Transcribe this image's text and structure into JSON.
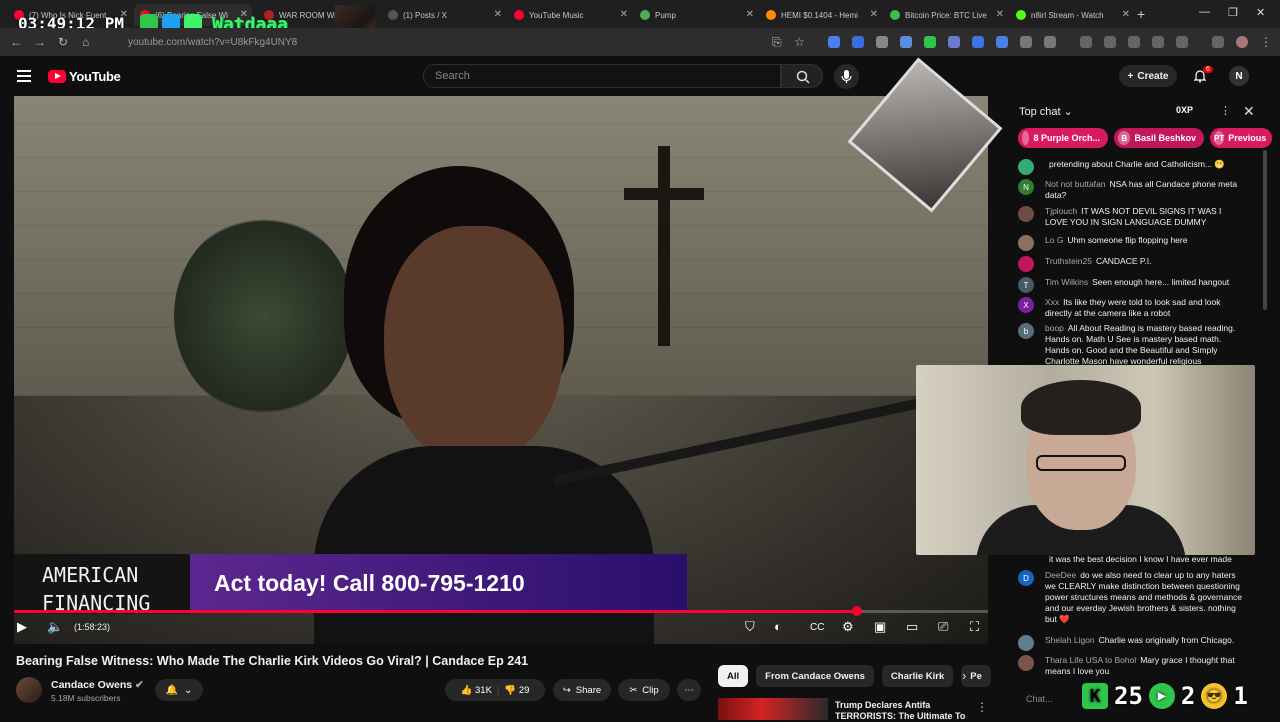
{
  "browser": {
    "clock": "03:49:12 PM",
    "overlay_name": "Watdaaa",
    "tabs": [
      {
        "label": "(7) Who Is Nick Fuent",
        "color": "#ff0033"
      },
      {
        "label": "(6) Bearing False Wi",
        "color": "#ff0033"
      },
      {
        "label": "WAR ROOM Wi",
        "color": "#b02020"
      },
      {
        "label": "(1) Posts / X",
        "color": "#555555"
      },
      {
        "label": "YouTube Music",
        "color": "#ff0033"
      },
      {
        "label": "Pump",
        "color": "#4caf50"
      },
      {
        "label": "HEMI $0.1404 - Hemi",
        "color": "#ff8c00"
      },
      {
        "label": "Bitcoin Price: BTC Live",
        "color": "#3fb950"
      },
      {
        "label": "n8irl Stream - Watch",
        "color": "#53fc18"
      }
    ],
    "url": "youtube.com/watch?v=U8kFkg4UNY8"
  },
  "yt_header": {
    "logo": "YouTube",
    "search_placeholder": "Search",
    "create_label": "Create",
    "notifications": "6",
    "user_initial": "N"
  },
  "video": {
    "ad_brand": "AMERICAN FINANCING",
    "ad_text": "Act today! Call 800-795-1210",
    "time": "(1:58:23)",
    "progress": 0.865
  },
  "chat": {
    "title": "Top chat",
    "xp_label": "0XP",
    "pinned": [
      {
        "label": "8 Purple Orch...",
        "initial": "",
        "color": "#d81b60"
      },
      {
        "label": "Basil Beshkov",
        "initial": "B",
        "color": "#c2185b"
      },
      {
        "label": "Previous",
        "initial": "PT",
        "color": "#d81b60"
      }
    ],
    "messages": [
      {
        "initial": "",
        "author": "",
        "text": "pretending about Charlie and Catholicism... 😬",
        "color": "#3a7"
      },
      {
        "initial": "N",
        "author": "Not not buttafan",
        "text": "NSA has all Candace phone meta data?",
        "color": "#2e7d32"
      },
      {
        "initial": "",
        "author": "Tjplouch",
        "text": "IT WAS NOT DEVIL SIGNS IT WAS I LOVE YOU IN SIGN LANGUAGE DUMMY",
        "color": "#6d4c41"
      },
      {
        "initial": "",
        "author": "Lo G",
        "text": "Uhm someone flip flopping here",
        "color": "#8d6e63"
      },
      {
        "initial": "",
        "author": "Truthstein25",
        "text": "CANDACE P.I.",
        "color": "#c2185b"
      },
      {
        "initial": "T",
        "author": "Tim Wilkins",
        "text": "Seen enough here... limited hangout",
        "color": "#455a64"
      },
      {
        "initial": "X",
        "author": "Xxx",
        "text": "Its like they were told to look sad and look directly at the camera like a robot",
        "color": "#7b1fa2"
      },
      {
        "initial": "b",
        "author": "boop",
        "text": "All About Reading is mastery based reading. Hands on. Math U See is mastery based math. Hands on. Good and the Beautiful and Simply Charlotte Mason have wonderful religious",
        "color": "#546e7a"
      },
      {
        "initial": "",
        "author": "",
        "text": "it was the best decision I know I have ever made",
        "color": "#444"
      },
      {
        "initial": "D",
        "author": "DeeDee",
        "text": "do we also need to clear up to any haters we CLEARLY make distinction between questioning power structures means and methods & governance and our everday Jewish brothers & sisters. nothing but ❤️",
        "color": "#1565c0"
      },
      {
        "initial": "",
        "author": "Shelah Ligon",
        "text": "Charlie was originally from Chicago.",
        "color": "#607d8b"
      },
      {
        "initial": "",
        "author": "Thara Life USA to Bohol",
        "text": "Mary grace I thought that means I love you",
        "color": "#795548"
      }
    ],
    "input_placeholder": "Chat...",
    "hud": {
      "count_a": "25",
      "count_b": "2",
      "count_c": "1"
    }
  },
  "below": {
    "title": "Bearing False Witness: Who Made The Charlie Kirk Videos Go Viral? | Candace Ep 241",
    "channel": "Candace Owens",
    "subs": "5.18M subscribers",
    "likes": "31K",
    "dislikes": "29",
    "share": "Share",
    "clip": "Clip",
    "chips": [
      "All",
      "From Candace Owens",
      "Charlie Kirk",
      "Pe"
    ],
    "rec_title": "Trump Declares Antifa TERRORISTS: The Ultimate To"
  }
}
